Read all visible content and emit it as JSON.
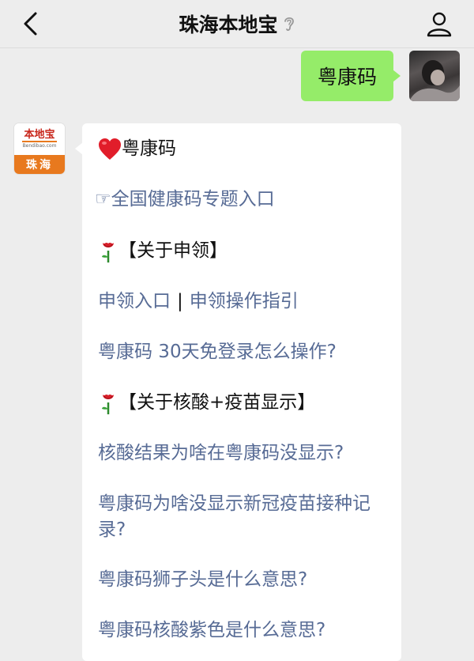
{
  "header": {
    "title": "珠海本地宝"
  },
  "outgoing_message": {
    "text": "粤康码"
  },
  "bot_avatar": {
    "logo_text": "本地宝",
    "logo_url": "Bendibao.com",
    "city": "珠海"
  },
  "reply": {
    "title": "粤康码",
    "national_entry": "☞全国健康码专题入口",
    "section_apply": "【关于申领】",
    "apply_entry": "申领入口",
    "separator": "|",
    "apply_guide": "申领操作指引",
    "q_30day": "粤康码 30天免登录怎么操作?",
    "section_nucleic": "【关于核酸+疫苗显示】",
    "q_nucleic_result": "核酸结果为啥在粤康码没显示?",
    "q_vaccine_record": "粤康码为啥没显示新冠疫苗接种记录?",
    "q_lion_head": "粤康码狮子头是什么意思?",
    "q_purple": "粤康码核酸紫色是什么意思?"
  },
  "colors": {
    "background": "#ededed",
    "my_bubble": "#95ec69",
    "link": "#576b95",
    "logo_orange": "#e8791e",
    "logo_red": "#c8261b"
  },
  "icons": {
    "back": "chevron-left-icon",
    "ear": "ear-icon",
    "user": "user-icon",
    "heart": "red-heart-icon",
    "rose": "rose-icon"
  }
}
